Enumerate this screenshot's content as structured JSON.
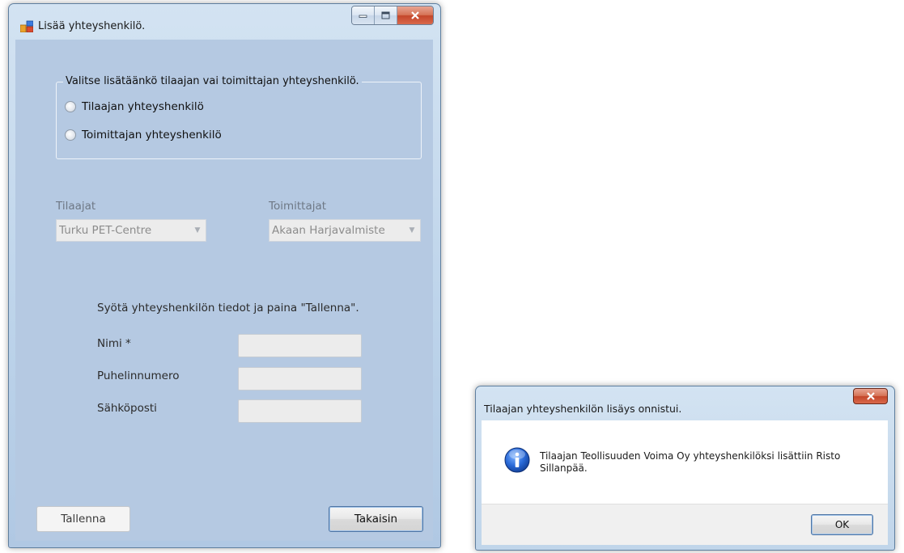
{
  "main_window": {
    "title": "Lisää yhteyshenkilö.",
    "group": {
      "legend": "Valitse lisätäänkö tilaajan vai toimittajan yhteyshenkilö.",
      "options": [
        {
          "label": "Tilaajan yhteyshenkilö",
          "checked": false
        },
        {
          "label": "Toimittajan yhteyshenkilö",
          "checked": false
        }
      ]
    },
    "tilaajat": {
      "label": "Tilaajat",
      "value": "Turku PET-Centre"
    },
    "toimittajat": {
      "label": "Toimittajat",
      "value": "Akaan Harjavalmiste"
    },
    "instructions": "Syötä yhteyshenkilön tiedot ja paina \"Tallenna\".",
    "fields": [
      {
        "label": "Nimi *",
        "value": ""
      },
      {
        "label": "Puhelinnumero",
        "value": ""
      },
      {
        "label": "Sähköposti",
        "value": ""
      }
    ],
    "buttons": {
      "save": "Tallenna",
      "back": "Takaisin"
    }
  },
  "message_box": {
    "title": "Tilaajan yhteyshenkilön lisäys onnistui.",
    "message": "Tilaajan Teollisuuden Voima Oy yhteyshenkilöksi lisättiin Risto Sillanpää.",
    "ok_label": "OK",
    "icon": "info-icon"
  },
  "colors": {
    "window_bg": "#b5c9e2",
    "close_button": "#c4462a",
    "ok_border": "#4f75a3"
  }
}
